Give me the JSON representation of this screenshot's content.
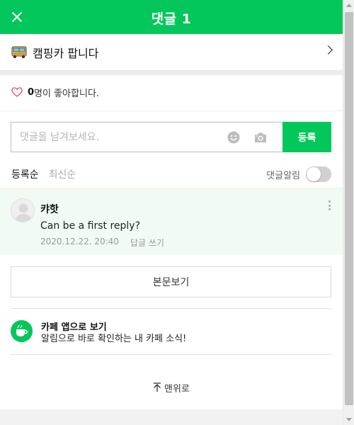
{
  "header": {
    "title": "댓글 1"
  },
  "post": {
    "title": "캠핑카 팝니다",
    "icon": "bus-icon"
  },
  "likes": {
    "count": "0",
    "suffix": "명이 좋아합니다."
  },
  "comment_form": {
    "placeholder": "댓글을 남겨보세요.",
    "submit_label": "등록"
  },
  "sort": {
    "tabs": [
      {
        "label": "등록순",
        "active": true
      },
      {
        "label": "최신순",
        "active": false
      }
    ]
  },
  "notify": {
    "label": "댓글알림",
    "enabled": false
  },
  "comments": [
    {
      "author": "캬핫",
      "text": "Can be a first reply?",
      "date": "2020.12.22. 20:40",
      "reply_label": "답글 쓰기"
    }
  ],
  "show_post_label": "본문보기",
  "promo": {
    "title": "카페 앱으로 보기",
    "subtitle": "알림으로 바로 확인하는 내 카페 소식!"
  },
  "back_to_top_label": "맨위로",
  "colors": {
    "accent": "#03c75a",
    "comment_bg": "#f1fbf4",
    "heart": "#e8486b"
  }
}
